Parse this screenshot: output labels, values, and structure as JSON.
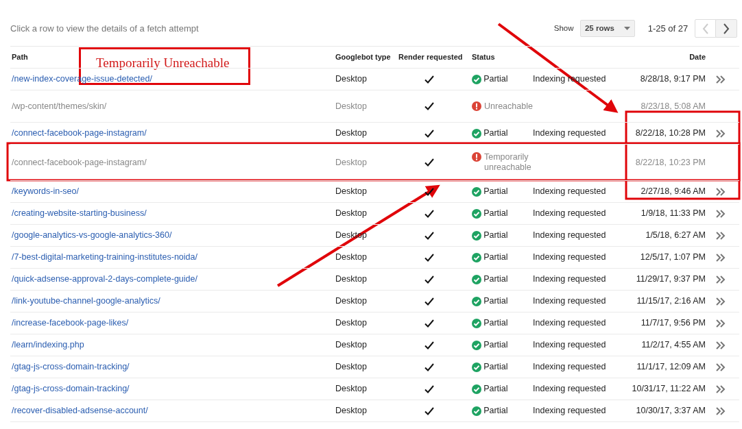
{
  "header": {
    "hint": "Click a row to view the details of a fetch attempt",
    "show_label": "Show",
    "rows_select": "25 rows",
    "range": "1-25 of 27",
    "prev_disabled": true
  },
  "table": {
    "columns": [
      "Path",
      "Googlebot type",
      "Render requested",
      "Status",
      "Date"
    ],
    "rows": [
      {
        "path": "/new-index-coverage-issue-detected/",
        "type": "Desktop",
        "render_requested": true,
        "kind": "partial",
        "status": "Partial",
        "action": "Indexing requested",
        "date": "8/28/18, 9:17 PM"
      },
      {
        "path": "/wp-content/themes/skin/",
        "type": "Desktop",
        "render_requested": true,
        "kind": "error",
        "status": "Unreachable",
        "date": "8/23/18, 5:08 AM"
      },
      {
        "path": "/connect-facebook-page-instagram/",
        "type": "Desktop",
        "render_requested": true,
        "kind": "partial",
        "status": "Partial",
        "action": "Indexing requested",
        "date": "8/22/18, 10:28 PM"
      },
      {
        "path": "/connect-facebook-page-instagram/",
        "type": "Desktop",
        "render_requested": true,
        "kind": "error",
        "status": "Temporarily unreachable",
        "date": "8/22/18, 10:23 PM"
      },
      {
        "path": "/keywords-in-seo/",
        "type": "Desktop",
        "render_requested": true,
        "kind": "partial",
        "status": "Partial",
        "action": "Indexing requested",
        "date": "2/27/18, 9:46 AM"
      },
      {
        "path": "/creating-website-starting-business/",
        "type": "Desktop",
        "render_requested": true,
        "kind": "partial",
        "status": "Partial",
        "action": "Indexing requested",
        "date": "1/9/18, 11:33 PM"
      },
      {
        "path": "/google-analytics-vs-google-analytics-360/",
        "type": "Desktop",
        "render_requested": true,
        "kind": "partial",
        "status": "Partial",
        "action": "Indexing requested",
        "date": "1/5/18, 6:27 AM"
      },
      {
        "path": "/7-best-digital-marketing-training-institutes-noida/",
        "type": "Desktop",
        "render_requested": true,
        "kind": "partial",
        "status": "Partial",
        "action": "Indexing requested",
        "date": "12/5/17, 1:07 PM"
      },
      {
        "path": "/quick-adsense-approval-2-days-complete-guide/",
        "type": "Desktop",
        "render_requested": true,
        "kind": "partial",
        "status": "Partial",
        "action": "Indexing requested",
        "date": "11/29/17, 9:37 PM"
      },
      {
        "path": "/link-youtube-channel-google-analytics/",
        "type": "Desktop",
        "render_requested": true,
        "kind": "partial",
        "status": "Partial",
        "action": "Indexing requested",
        "date": "11/15/17, 2:16 AM"
      },
      {
        "path": "/increase-facebook-page-likes/",
        "type": "Desktop",
        "render_requested": true,
        "kind": "partial",
        "status": "Partial",
        "action": "Indexing requested",
        "date": "11/7/17, 9:56 PM"
      },
      {
        "path": "/learn/indexing.php",
        "type": "Desktop",
        "render_requested": true,
        "kind": "partial",
        "status": "Partial",
        "action": "Indexing requested",
        "date": "11/2/17, 4:55 AM"
      },
      {
        "path": "/gtag-js-cross-domain-tracking/",
        "type": "Desktop",
        "render_requested": true,
        "kind": "partial",
        "status": "Partial",
        "action": "Indexing requested",
        "date": "11/1/17, 12:09 AM"
      },
      {
        "path": "/gtag-js-cross-domain-tracking/",
        "type": "Desktop",
        "render_requested": true,
        "kind": "partial",
        "status": "Partial",
        "action": "Indexing requested",
        "date": "10/31/17, 11:22 AM"
      },
      {
        "path": "/recover-disabled-adsense-account/",
        "type": "Desktop",
        "render_requested": true,
        "kind": "partial",
        "status": "Partial",
        "action": "Indexing requested",
        "date": "10/30/17, 3:37 AM"
      }
    ]
  },
  "annotation": {
    "label": "Temporarily Unreachable"
  }
}
